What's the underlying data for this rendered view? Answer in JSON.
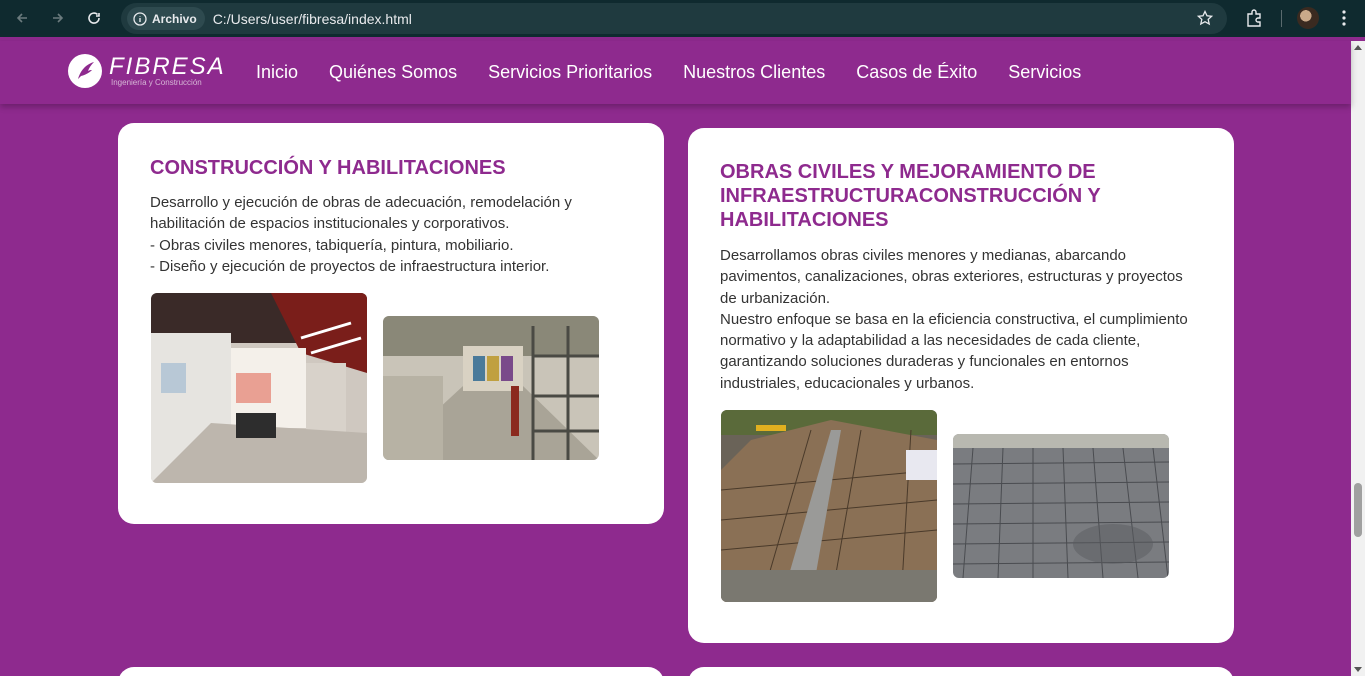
{
  "browser": {
    "site_chip": "Archivo",
    "url": "C:/Users/user/fibresa/index.html"
  },
  "header": {
    "logo_name": "FIBRESA",
    "logo_tagline": "Ingeniería y Construcción",
    "menu": [
      "Inicio",
      "Quiénes Somos",
      "Servicios Prioritarios",
      "Nuestros Clientes",
      "Casos de Éxito",
      "Servicios"
    ]
  },
  "cards": [
    {
      "title": "CONSTRUCCIÓN Y HABILITACIONES",
      "body": "Desarrollo y ejecución de obras de adecuación, remodelación y habilitación de espacios institucionales y corporativos.\n- Obras civiles menores, tabiquería, pintura, mobiliario.\n- Diseño y ejecución de proyectos de infraestructura interior.",
      "images": [
        "interior-remodel-photo",
        "corridor-scaffolding-photo"
      ]
    },
    {
      "title": "OBRAS CIVILES Y MEJORAMIENTO DE INFRAESTRUCTURACONSTRUCCIÓN Y HABILITACIONES",
      "body": "Desarrollamos obras civiles menores y medianas, abarcando pavimentos, canalizaciones, obras exteriores, estructuras y proyectos de urbanización.\nNuestro enfoque se basa en la eficiencia constructiva, el cumplimiento normativo y la adaptabilidad a las necesidades de cada cliente, garantizando soluciones duraderas y funcionales en entornos industriales, educacionales y urbanos.",
      "images": [
        "rebar-pavement-photo",
        "concrete-slab-photo"
      ]
    }
  ],
  "colors": {
    "brand_purple": "#8e2a8e",
    "card_bg": "#ffffff",
    "chrome_bg": "#0f2a2f"
  }
}
